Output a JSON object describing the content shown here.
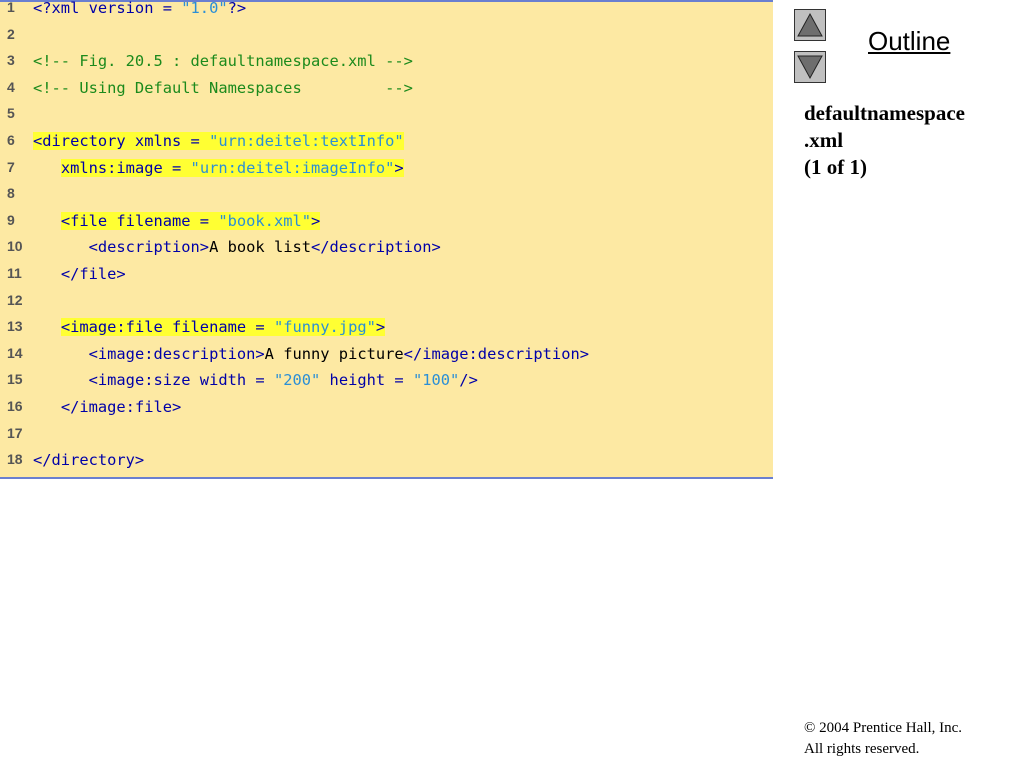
{
  "outline": {
    "title": "Outline",
    "up_icon": "triangle-up-icon",
    "down_icon": "triangle-down-icon"
  },
  "file_label": {
    "name": "defaultnamespace",
    "ext": ".xml",
    "page": "(1 of 1)"
  },
  "footer": {
    "copyright": "© 2004 Prentice Hall, Inc.",
    "rights": "All rights reserved."
  },
  "colors": {
    "tag": "#0000a8",
    "string": "#2b8fd6",
    "comment": "#1c8a1c",
    "highlight": "#ffff33",
    "background": "#fde9a3"
  },
  "code": [
    {
      "n": "1",
      "hl": false,
      "indent": "",
      "segs": [
        {
          "t": "<?xml version = ",
          "c": "tag"
        },
        {
          "t": "\"1.0\"",
          "c": "str"
        },
        {
          "t": "?>",
          "c": "tag"
        }
      ]
    },
    {
      "n": "2",
      "hl": false,
      "indent": "",
      "segs": []
    },
    {
      "n": "3",
      "hl": false,
      "indent": "",
      "segs": [
        {
          "t": "<!-- Fig. 20.5 : defaultnamespace.xml -->",
          "c": "com"
        }
      ]
    },
    {
      "n": "4",
      "hl": false,
      "indent": "",
      "segs": [
        {
          "t": "<!-- Using Default Namespaces         -->",
          "c": "com"
        }
      ]
    },
    {
      "n": "5",
      "hl": false,
      "indent": "",
      "segs": []
    },
    {
      "n": "6",
      "hl": true,
      "indent": "",
      "segs": [
        {
          "t": "<directory xmlns = ",
          "c": "tag"
        },
        {
          "t": "\"urn:deitel:textInfo\"",
          "c": "str"
        }
      ]
    },
    {
      "n": "7",
      "hl": true,
      "indent": "   ",
      "segs": [
        {
          "t": "xmlns:image = ",
          "c": "tag"
        },
        {
          "t": "\"urn:deitel:imageInfo\"",
          "c": "str"
        },
        {
          "t": ">",
          "c": "tag"
        }
      ]
    },
    {
      "n": "8",
      "hl": false,
      "indent": "",
      "segs": []
    },
    {
      "n": "9",
      "hl": true,
      "indent": "   ",
      "segs": [
        {
          "t": "<file filename = ",
          "c": "tag"
        },
        {
          "t": "\"book.xml\"",
          "c": "str"
        },
        {
          "t": ">",
          "c": "tag"
        }
      ]
    },
    {
      "n": "10",
      "hl": false,
      "indent": "      ",
      "segs": [
        {
          "t": "<description>",
          "c": "tag"
        },
        {
          "t": "A book list",
          "c": "txt"
        },
        {
          "t": "</description>",
          "c": "tag"
        }
      ]
    },
    {
      "n": "11",
      "hl": false,
      "indent": "   ",
      "segs": [
        {
          "t": "</file>",
          "c": "tag"
        }
      ]
    },
    {
      "n": "12",
      "hl": false,
      "indent": "",
      "segs": []
    },
    {
      "n": "13",
      "hl": true,
      "indent": "   ",
      "segs": [
        {
          "t": "<image:file filename = ",
          "c": "tag"
        },
        {
          "t": "\"funny.jpg\"",
          "c": "str"
        },
        {
          "t": ">",
          "c": "tag"
        }
      ]
    },
    {
      "n": "14",
      "hl": false,
      "indent": "      ",
      "segs": [
        {
          "t": "<image:description>",
          "c": "tag"
        },
        {
          "t": "A funny picture",
          "c": "txt"
        },
        {
          "t": "</image:description>",
          "c": "tag"
        }
      ]
    },
    {
      "n": "15",
      "hl": false,
      "indent": "      ",
      "segs": [
        {
          "t": "<image:size width = ",
          "c": "tag"
        },
        {
          "t": "\"200\"",
          "c": "str"
        },
        {
          "t": " height = ",
          "c": "tag"
        },
        {
          "t": "\"100\"",
          "c": "str"
        },
        {
          "t": "/>",
          "c": "tag"
        }
      ]
    },
    {
      "n": "16",
      "hl": false,
      "indent": "   ",
      "segs": [
        {
          "t": "</image:file>",
          "c": "tag"
        }
      ]
    },
    {
      "n": "17",
      "hl": false,
      "indent": "",
      "segs": []
    },
    {
      "n": "18",
      "hl": false,
      "indent": "",
      "segs": [
        {
          "t": "</directory>",
          "c": "tag"
        }
      ]
    }
  ]
}
